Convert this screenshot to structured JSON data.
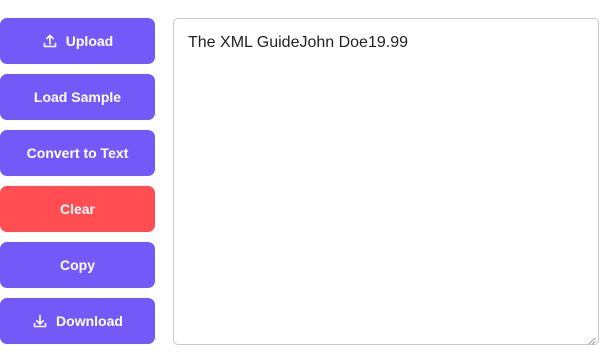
{
  "actions": {
    "upload": {
      "label": "Upload",
      "icon": "upload-icon"
    },
    "load_sample": {
      "label": "Load Sample"
    },
    "convert": {
      "label": "Convert to Text"
    },
    "clear": {
      "label": "Clear"
    },
    "copy": {
      "label": "Copy"
    },
    "download": {
      "label": "Download",
      "icon": "download-icon"
    }
  },
  "editor": {
    "value": "The XML GuideJohn Doe19.99"
  },
  "colors": {
    "primary": "#7459f9",
    "danger": "#ff4d52",
    "border": "#c9c9c9"
  }
}
